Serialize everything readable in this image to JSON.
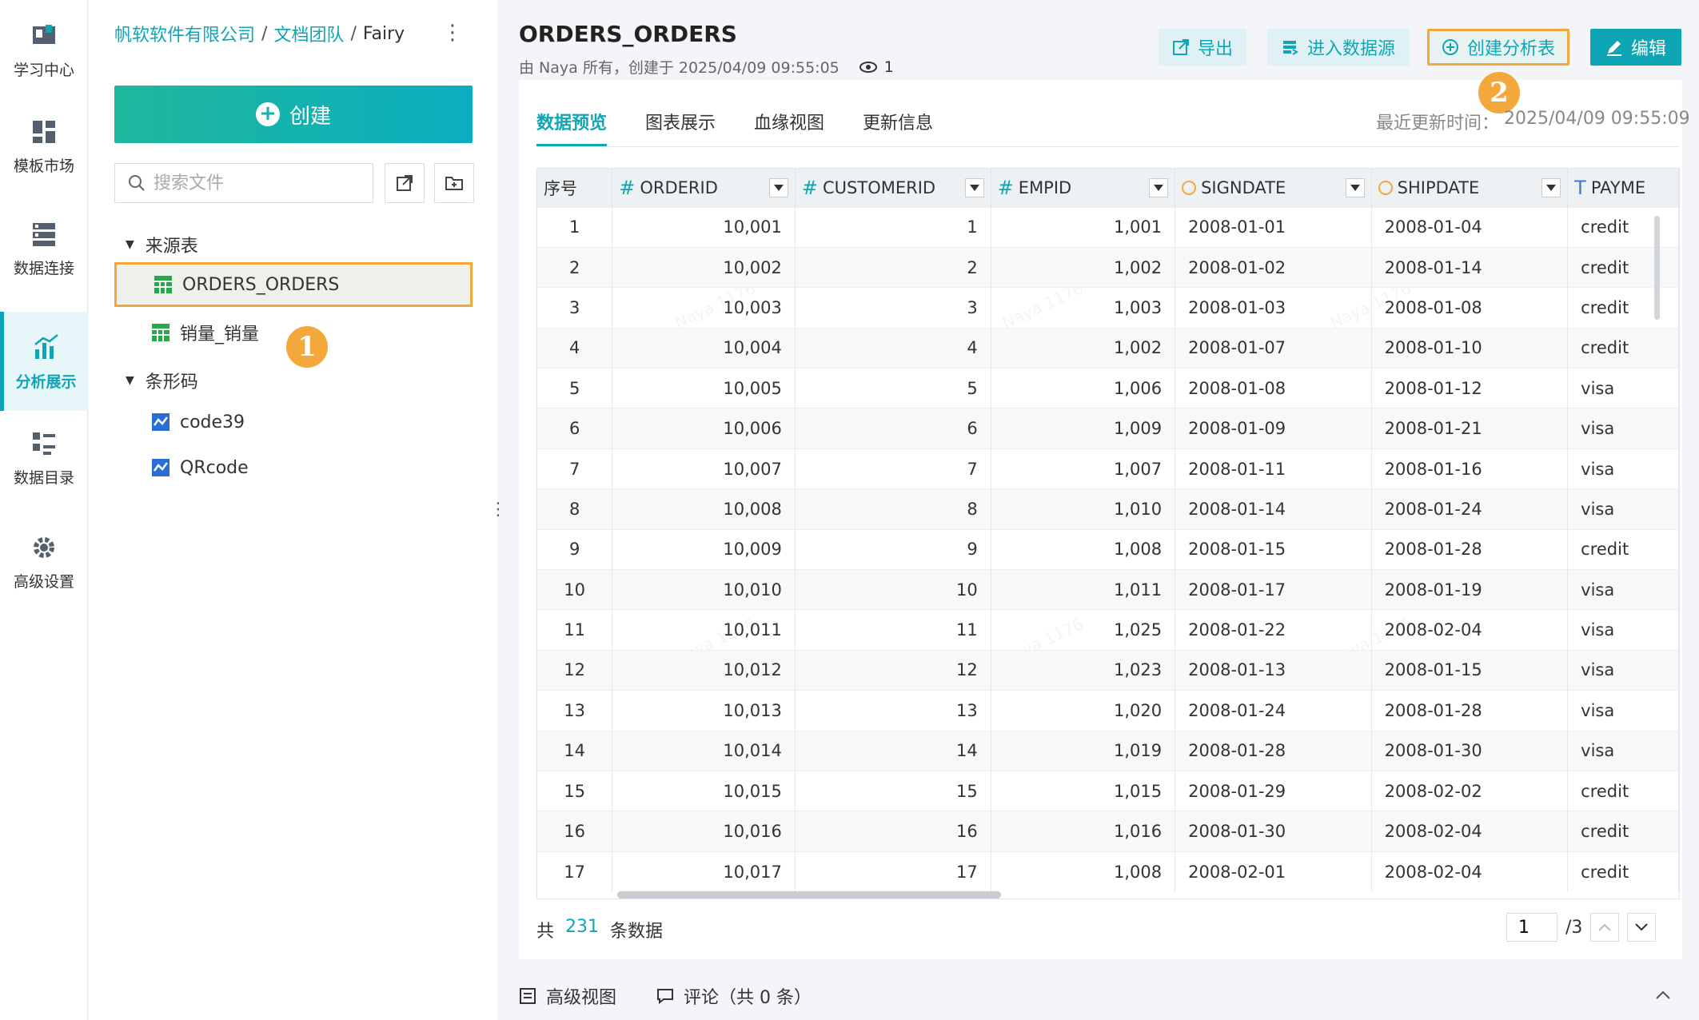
{
  "rail": [
    {
      "label": "学习中心",
      "icon": "learning-icon"
    },
    {
      "label": "模板市场",
      "icon": "template-icon"
    },
    {
      "label": "数据连接",
      "icon": "data-connection-icon"
    },
    {
      "label": "分析展示",
      "icon": "analysis-icon",
      "active": true
    },
    {
      "label": "数据目录",
      "icon": "catalog-icon"
    },
    {
      "label": "高级设置",
      "icon": "gear-icon"
    }
  ],
  "breadcrumb": {
    "org": "帆软软件有限公司",
    "sep": "/",
    "team": "文档团队",
    "current": "Fairy"
  },
  "create_label": "创建",
  "search_placeholder": "搜索文件",
  "tree": {
    "group1": "来源表",
    "items1": [
      "ORDERS_ORDERS",
      "销量_销量"
    ],
    "group2": "条形码",
    "items2": [
      "code39",
      "QRcode"
    ]
  },
  "badges": {
    "one": "1",
    "two": "2"
  },
  "header": {
    "title": "ORDERS_ORDERS",
    "subtitle": "由 Naya 所有，创建于 2025/04/09 09:55:05",
    "views": "1",
    "export": "导出",
    "enter_source": "进入数据源",
    "create_analysis": "创建分析表",
    "edit": "编辑"
  },
  "tabs": [
    "数据预览",
    "图表展示",
    "血缘视图",
    "更新信息"
  ],
  "last_update": {
    "label": "最近更新时间：",
    "value": "2025/04/09 09:55:09"
  },
  "table": {
    "columns": [
      "序号",
      "ORDERID",
      "CUSTOMERID",
      "EMPID",
      "SIGNDATE",
      "SHIPDATE",
      "PAYME"
    ],
    "rows": [
      [
        "1",
        "10,001",
        "1",
        "1,001",
        "2008-01-01",
        "2008-01-04",
        "credit"
      ],
      [
        "2",
        "10,002",
        "2",
        "1,002",
        "2008-01-02",
        "2008-01-14",
        "credit"
      ],
      [
        "3",
        "10,003",
        "3",
        "1,003",
        "2008-01-03",
        "2008-01-08",
        "credit"
      ],
      [
        "4",
        "10,004",
        "4",
        "1,002",
        "2008-01-07",
        "2008-01-10",
        "credit"
      ],
      [
        "5",
        "10,005",
        "5",
        "1,006",
        "2008-01-08",
        "2008-01-12",
        "visa"
      ],
      [
        "6",
        "10,006",
        "6",
        "1,009",
        "2008-01-09",
        "2008-01-21",
        "visa"
      ],
      [
        "7",
        "10,007",
        "7",
        "1,007",
        "2008-01-11",
        "2008-01-16",
        "visa"
      ],
      [
        "8",
        "10,008",
        "8",
        "1,010",
        "2008-01-14",
        "2008-01-24",
        "visa"
      ],
      [
        "9",
        "10,009",
        "9",
        "1,008",
        "2008-01-15",
        "2008-01-28",
        "credit"
      ],
      [
        "10",
        "10,010",
        "10",
        "1,011",
        "2008-01-17",
        "2008-01-19",
        "visa"
      ],
      [
        "11",
        "10,011",
        "11",
        "1,025",
        "2008-01-22",
        "2008-02-04",
        "visa"
      ],
      [
        "12",
        "10,012",
        "12",
        "1,023",
        "2008-01-13",
        "2008-01-15",
        "visa"
      ],
      [
        "13",
        "10,013",
        "13",
        "1,020",
        "2008-01-24",
        "2008-01-28",
        "visa"
      ],
      [
        "14",
        "10,014",
        "14",
        "1,019",
        "2008-01-28",
        "2008-01-30",
        "visa"
      ],
      [
        "15",
        "10,015",
        "15",
        "1,015",
        "2008-01-29",
        "2008-02-02",
        "credit"
      ],
      [
        "16",
        "10,016",
        "16",
        "1,016",
        "2008-01-30",
        "2008-02-04",
        "credit"
      ],
      [
        "17",
        "10,017",
        "17",
        "1,008",
        "2008-02-01",
        "2008-02-04",
        "credit"
      ]
    ]
  },
  "footer": {
    "prefix": "共",
    "count": "231",
    "suffix": "条数据",
    "page": "1",
    "total_pages": "/3"
  },
  "bottom": {
    "advanced_view": "高级视图",
    "comments": "评论（共 0 条）"
  },
  "watermark": "Naya 1176",
  "colors": {
    "accent": "#0ea6b5",
    "highlight": "#f4a73a"
  }
}
